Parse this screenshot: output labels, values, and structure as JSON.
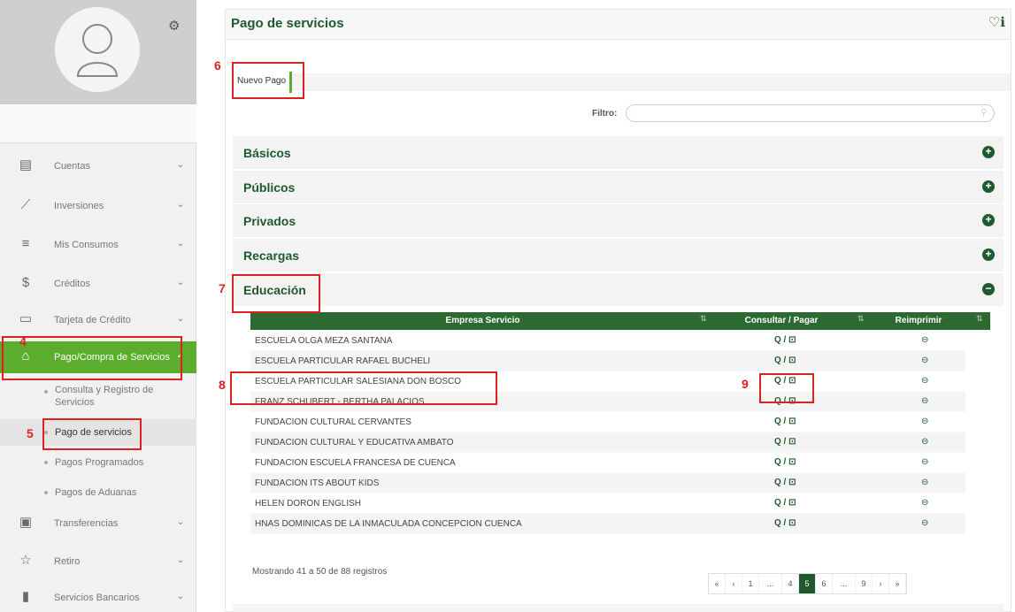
{
  "sidebar": {
    "gear_icon": "gear-icon",
    "items": [
      {
        "label": "Cuentas",
        "icon": "documents-icon"
      },
      {
        "label": "Inversiones",
        "icon": "line-chart-icon"
      },
      {
        "label": "Mis Consumos",
        "icon": "list-icon"
      },
      {
        "label": "Créditos",
        "icon": "dollar-icon"
      },
      {
        "label": "Tarjeta de Crédito",
        "icon": "credit-card-icon"
      },
      {
        "label": "Pago/Compra de Servicios",
        "icon": "home-icon"
      }
    ],
    "sub_items": [
      {
        "label": "Consulta y Registro de Servicios"
      },
      {
        "label": "Pago de servicios"
      },
      {
        "label": "Pagos Programados"
      },
      {
        "label": "Pagos de Aduanas"
      }
    ],
    "items_after": [
      {
        "label": "Transferencias",
        "icon": "cash-icon"
      },
      {
        "label": "Retiro",
        "icon": "star-icon"
      },
      {
        "label": "Servicios Bancarios",
        "icon": "briefcase-icon"
      }
    ]
  },
  "header": {
    "title": "Pago de servicios"
  },
  "tab": {
    "label": "Nuevo Pago"
  },
  "filter": {
    "label": "Filtro:",
    "value": ""
  },
  "categories": [
    {
      "label": "Básicos",
      "toggle": "+"
    },
    {
      "label": "Públicos",
      "toggle": "+"
    },
    {
      "label": "Privados",
      "toggle": "+"
    },
    {
      "label": "Recargas",
      "toggle": "+"
    },
    {
      "label": "Educación",
      "toggle": "−"
    }
  ],
  "table": {
    "headers": [
      "Empresa Servicio",
      "Consultar / Pagar",
      "Reimprimir"
    ],
    "action_text": "Q / ⊡",
    "print_text": "⊖",
    "rows": [
      "ESCUELA OLGA MEZA SANTANA",
      "ESCUELA PARTICULAR RAFAEL BUCHELI",
      "ESCUELA PARTICULAR SALESIANA DON BOSCO",
      "FRANZ SCHUBERT - BERTHA PALACIOS",
      "FUNDACION CULTURAL CERVANTES",
      "FUNDACION CULTURAL Y EDUCATIVA AMBATO",
      "FUNDACION ESCUELA FRANCESA DE CUENCA",
      "FUNDACION ITS ABOUT KIDS",
      "HELEN DORON ENGLISH",
      "HNAS DOMINICAS DE LA INMACULADA CONCEPCION CUENCA"
    ]
  },
  "records": "Mostrando 41 a 50 de 88 registros",
  "pagination": [
    "«",
    "‹",
    "1",
    "...",
    "4",
    "5",
    "6",
    "...",
    "9",
    "›",
    "»"
  ],
  "annotations": [
    "4",
    "5",
    "6",
    "7",
    "8",
    "9"
  ],
  "colors": {
    "accent": "#5cad2e",
    "dark_green": "#1f5a2f",
    "annotation": "#e02020"
  }
}
